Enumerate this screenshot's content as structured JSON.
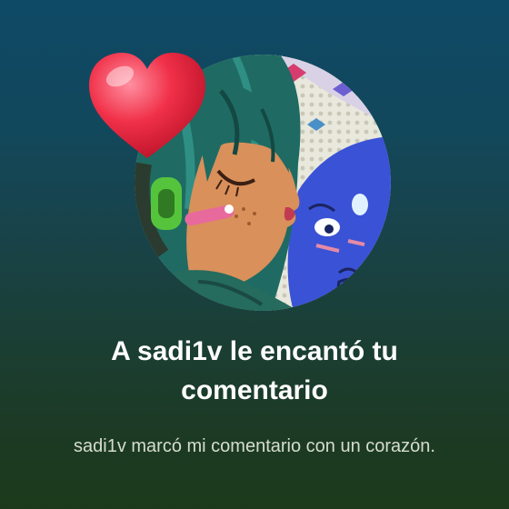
{
  "notification": {
    "title": "A sadi1v le encantó tu comentario",
    "subtitle": "sadi1v marcó mi comentario con un corazón.",
    "username": "sadi1v",
    "avatar_icon": "user-avatar-illustration",
    "badge_icon": "heart-icon"
  },
  "colors": {
    "background_top": "#0e4966",
    "background_bottom": "#1c3a1b",
    "title": "#ffffff",
    "subtitle": "#d6dccf",
    "heart": "#e8203a"
  }
}
